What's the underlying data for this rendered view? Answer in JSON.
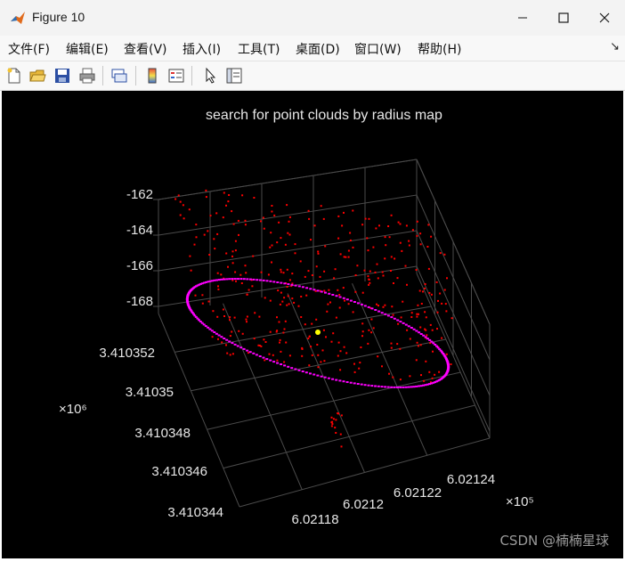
{
  "window": {
    "title": "Figure 10",
    "minimize_icon": "minimize-icon",
    "maximize_icon": "maximize-icon",
    "close_icon": "close-icon"
  },
  "menu": {
    "items": [
      "文件(F)",
      "编辑(E)",
      "查看(V)",
      "插入(I)",
      "工具(T)",
      "桌面(D)",
      "窗口(W)",
      "帮助(H)"
    ],
    "dock_glyph": "↘"
  },
  "toolbar": {
    "icons": [
      "new-figure-icon",
      "open-file-icon",
      "save-icon",
      "print-icon",
      "link-plot-icon",
      "colorbar-icon",
      "legend-icon",
      "pointer-icon",
      "property-inspector-icon"
    ]
  },
  "colors": {
    "figure_bg": "#000000",
    "grid": "#4a4a4a",
    "text": "#e6e6e6",
    "cloud_points": "#ff0000",
    "ring_points": "#ff00ff",
    "query_point": "#ffff00"
  },
  "chart_data": {
    "type": "scatter",
    "dimensions": 3,
    "title": "search for point clouds by radius map",
    "x_ticks": [
      "6.02118",
      "6.0212",
      "6.02122",
      "6.02124"
    ],
    "x_exponent": "×10⁵",
    "y_ticks": [
      "3.410344",
      "3.410346",
      "3.410348",
      "3.41035",
      "3.410352"
    ],
    "y_exponent": "×10⁶",
    "z_ticks": [
      "-162",
      "-164",
      "-166",
      "-168"
    ],
    "series": [
      {
        "color": "#ff0000",
        "shape": "scattered points"
      },
      {
        "color": "#ff00ff",
        "shape": "elliptical ring"
      },
      {
        "color": "#ffff00",
        "shape": "single point"
      }
    ],
    "grid": true,
    "legend": "none"
  },
  "watermark": "CSDN @楠楠星球"
}
